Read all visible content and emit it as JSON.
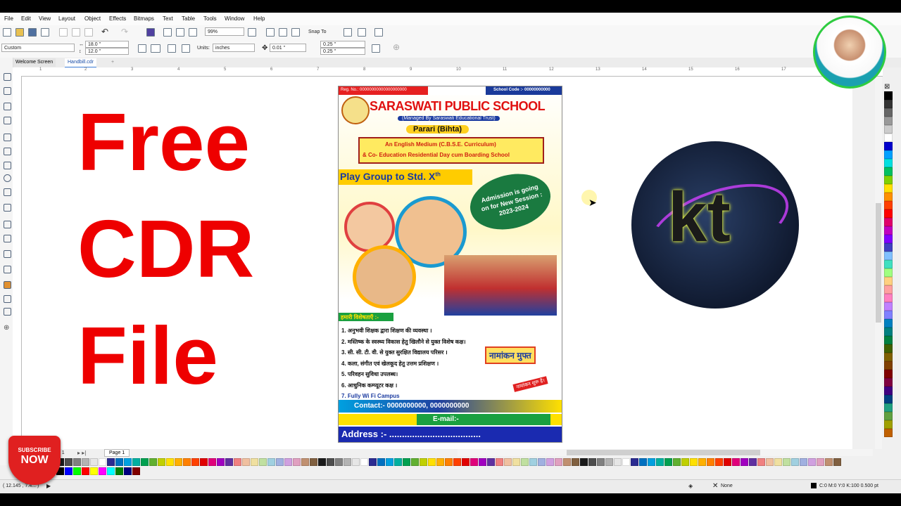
{
  "menu": [
    "File",
    "Edit",
    "View",
    "Layout",
    "Object",
    "Effects",
    "Bitmaps",
    "Text",
    "Table",
    "Tools",
    "Window",
    "Help"
  ],
  "toolbar": {
    "zoom": "99%",
    "snap_to": "Snap To",
    "page_size": "Custom",
    "width": "18.0 \"",
    "height": "12.0 \"",
    "units_label": "Units:",
    "units_value": "inches",
    "nudge": "0.01 \"",
    "dup_x": "0.25 \"",
    "dup_y": "0.25 \""
  },
  "tabs": [
    "Welcome Screen",
    "Handbill.cdr"
  ],
  "ruler_ticks": [
    "1",
    "2",
    "3",
    "4",
    "5",
    "6",
    "7",
    "8",
    "9",
    "10",
    "11",
    "12",
    "13",
    "14",
    "15",
    "16",
    "17"
  ],
  "overlay_text": [
    "Free",
    "CDR",
    "File"
  ],
  "flyer": {
    "reg_no": "Reg. No.: 00000000000000000000",
    "school_code": "School Code :- 00000000000",
    "school_name": "SARASWATI PUBLIC SCHOOL",
    "managed_by": "(Managed By Saraswati Educational Trust)",
    "location": "Parari (Bihta)",
    "line1": "An English Medium (C.B.S.E. Curriculum)",
    "line2": "& Co- Education Residential Day cum Boarding School",
    "play_group": "Play Group to Std. X",
    "play_group_sup": "th",
    "admission_line1": "Admission is going",
    "admission_line2": "on for New Session :",
    "admission_line3": "2023-2024",
    "features_heading": "हमारी विशेषताएँ :-",
    "features": [
      "1. अनुभवी शिक्षक द्वारा शिक्षण की व्यवस्था ।",
      "2. मस्तिष्क के स्वस्थ्य विकास हेतु खिलौने से युक्त विशेष कक्ष।",
      "3. सी. सी. टी. वी. से युक्त सुरक्षित विद्यालय परिसर ।",
      "4. कला, संगीत एवं खेलकूद हेतु उत्तम प्रशिक्षण ।",
      "5. परिवहन सुविधा उपलब्ध।",
      "6. आधुनिक कम्प्यूटर कक्ष ।",
      "7. Fully Wi Fi Campus"
    ],
    "free_admission": "नामांकन मुफ्त",
    "admission_started": "नामांकन शुरू है।",
    "contact": "Contact:- 0000000000, 0000000000",
    "email": "E-mail:-",
    "address": "Address :- ...................................."
  },
  "logo_text": "kt",
  "subscribe": {
    "line1": "SUBSCRIBE",
    "line2": "NOW"
  },
  "page_nav": {
    "of": "of 1",
    "page_tab": "Page 1"
  },
  "status": {
    "coords": "( 12.145 , 7.4... )",
    "fill_none": "None",
    "color_info": "C:0 M:0 Y:0 K:100  0.500 pt"
  },
  "palette": [
    "#1a1a1a",
    "#4d4d4d",
    "#808080",
    "#b3b3b3",
    "#e6e6e6",
    "#ffffff",
    "#2b2b91",
    "#0070c0",
    "#00a0e0",
    "#00b0a0",
    "#00a050",
    "#60b030",
    "#c0d000",
    "#ffe000",
    "#ffb000",
    "#ff8000",
    "#ff4000",
    "#e00000",
    "#e0007a",
    "#a000c0",
    "#6030a0",
    "#f08080",
    "#f0c0a0",
    "#f0e0a0",
    "#c0e0a0",
    "#a0d0e0",
    "#a0b0e0",
    "#d0a0e0",
    "#e0a0c0",
    "#c09070",
    "#806040"
  ],
  "palette2": [
    "#000000",
    "#0000ff",
    "#00ff00",
    "#ff0000",
    "#ffff00",
    "#ff00ff",
    "#00ffff",
    "#008000",
    "#000080",
    "#800000"
  ],
  "vpalette": [
    "#000000",
    "#333333",
    "#666666",
    "#999999",
    "#cccccc",
    "#ffffff",
    "#0000cc",
    "#00a0ff",
    "#00e0e0",
    "#00c060",
    "#80d000",
    "#ffe000",
    "#ff9000",
    "#ff4000",
    "#ff0000",
    "#e0006a",
    "#c000c0",
    "#8000ff",
    "#4040c0",
    "#80c0ff",
    "#40e0c0",
    "#a0ff80",
    "#ffd080",
    "#ffa0a0",
    "#ff80c0",
    "#c080ff",
    "#8080ff",
    "#0080c0",
    "#008080",
    "#008040",
    "#406000",
    "#806000",
    "#804000",
    "#800000",
    "#800040",
    "#400080",
    "#004080",
    "#20a080",
    "#60a040",
    "#a0a000",
    "#c06000"
  ]
}
